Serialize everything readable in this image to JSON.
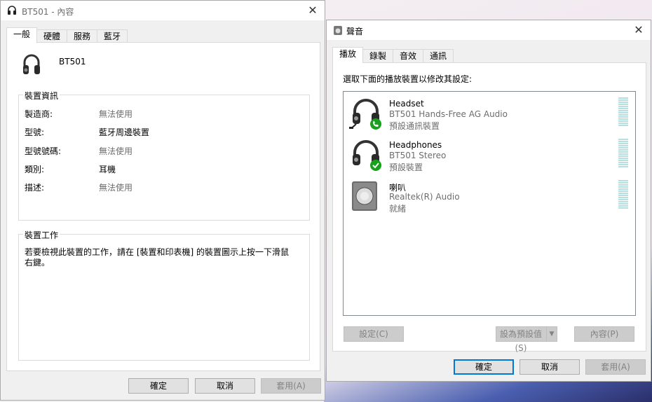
{
  "left_window": {
    "title": "BT501 - 內容",
    "tabs": [
      "一般",
      "硬體",
      "服務",
      "藍牙"
    ],
    "device_name": "BT501",
    "device_info": {
      "legend": "裝置資訊",
      "rows": [
        {
          "key": "製造商:",
          "value": "無法使用"
        },
        {
          "key": "型號:",
          "value": "藍牙周邊裝置"
        },
        {
          "key": "型號號碼:",
          "value": "無法使用"
        },
        {
          "key": "類別:",
          "value": "耳機"
        },
        {
          "key": "描述:",
          "value": "無法使用"
        }
      ]
    },
    "device_tasks": {
      "legend": "裝置工作",
      "text": "若要檢視此裝置的工作，請在 [裝置和印表機] 的裝置圖示上按一下滑鼠右鍵。"
    },
    "buttons": {
      "ok": "確定",
      "cancel": "取消",
      "apply": "套用(A)"
    }
  },
  "right_window": {
    "title": "聲音",
    "tabs": [
      "播放",
      "錄製",
      "音效",
      "通訊"
    ],
    "instruction": "選取下面的播放裝置以修改其設定:",
    "devices": [
      {
        "name": "Headset",
        "description": "BT501 Hands-Free AG Audio",
        "status": "預設通訊裝置",
        "icon": "headset-icon",
        "badge": "phone-badge-icon"
      },
      {
        "name": "Headphones",
        "description": "BT501 Stereo",
        "status": "預設裝置",
        "icon": "headphones-icon",
        "badge": "check-badge-icon"
      },
      {
        "name": "喇叭",
        "description": "Realtek(R) Audio",
        "status": "就緒",
        "icon": "speaker-icon"
      }
    ],
    "buttons": {
      "configure": "設定(C)",
      "set_default": "設為預設值(S)",
      "properties": "內容(P)",
      "ok": "確定",
      "cancel": "取消",
      "apply": "套用(A)"
    }
  },
  "colors": {
    "accent": "#0078d7",
    "badge_green": "#16a01c",
    "meter": "#b6e0e0"
  }
}
